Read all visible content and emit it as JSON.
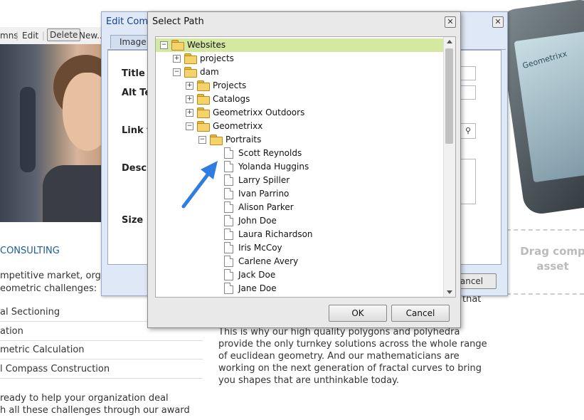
{
  "background": {
    "toolbar": {
      "columns_label": "mns",
      "edit_label": "Edit",
      "delete_label": "Delete",
      "new_label": "New..."
    },
    "consulting_heading": "CONSULTING",
    "intro_lines": [
      "mpetitive market, organi",
      "eometric challenges:"
    ],
    "list_items": [
      "al Sectioning",
      "ation",
      "metric Calculation",
      "l Compass Construction"
    ],
    "closing_lines": [
      "ready to help your organization deal",
      "h all these challenges through our award"
    ],
    "right_paragraph": "This is why our high quality polygons and polyhedra provide the only turnkey solutions across the whole range of euclidean geometry. And our mathematicians are working on the next generation of fractal curves to bring you shapes that are unthinkable today.",
    "that_fragment": "that",
    "drag_text_line1": "Drag comp",
    "drag_text_line2": "asset",
    "phone_brand": "Geometrixx"
  },
  "edit_dialog": {
    "title": "Edit Comp",
    "tab_image": "Image",
    "labels": {
      "title": "Title",
      "alt_text": "Alt Te",
      "link_to": "Link t",
      "description": "Descr",
      "size": "Size"
    },
    "cancel_label": "ancel"
  },
  "select_path": {
    "title": "Select Path",
    "close_glyph": "✕",
    "ok_label": "OK",
    "cancel_label": "Cancel",
    "tree": {
      "root": "Websites",
      "projects": "projects",
      "dam": "dam",
      "dam_children": [
        "Projects",
        "Catalogs",
        "Geometrixx Outdoors",
        "Geometrixx"
      ],
      "portraits": "Portraits",
      "assets": [
        "Scott Reynolds",
        "Yolanda Huggins",
        "Larry Spiller",
        "Ivan Parrino",
        "Alison Parker",
        "John Doe",
        "Laura Richardson",
        "Iris McCoy",
        "Carlene Avery",
        "Jack Doe",
        "Jane Doe"
      ]
    }
  },
  "colors": {
    "selected_row": "#d4e8a0",
    "folder_yellow": "#f6d36a",
    "arrow_blue": "#2f7de1",
    "heading_blue": "#1d5d93"
  }
}
